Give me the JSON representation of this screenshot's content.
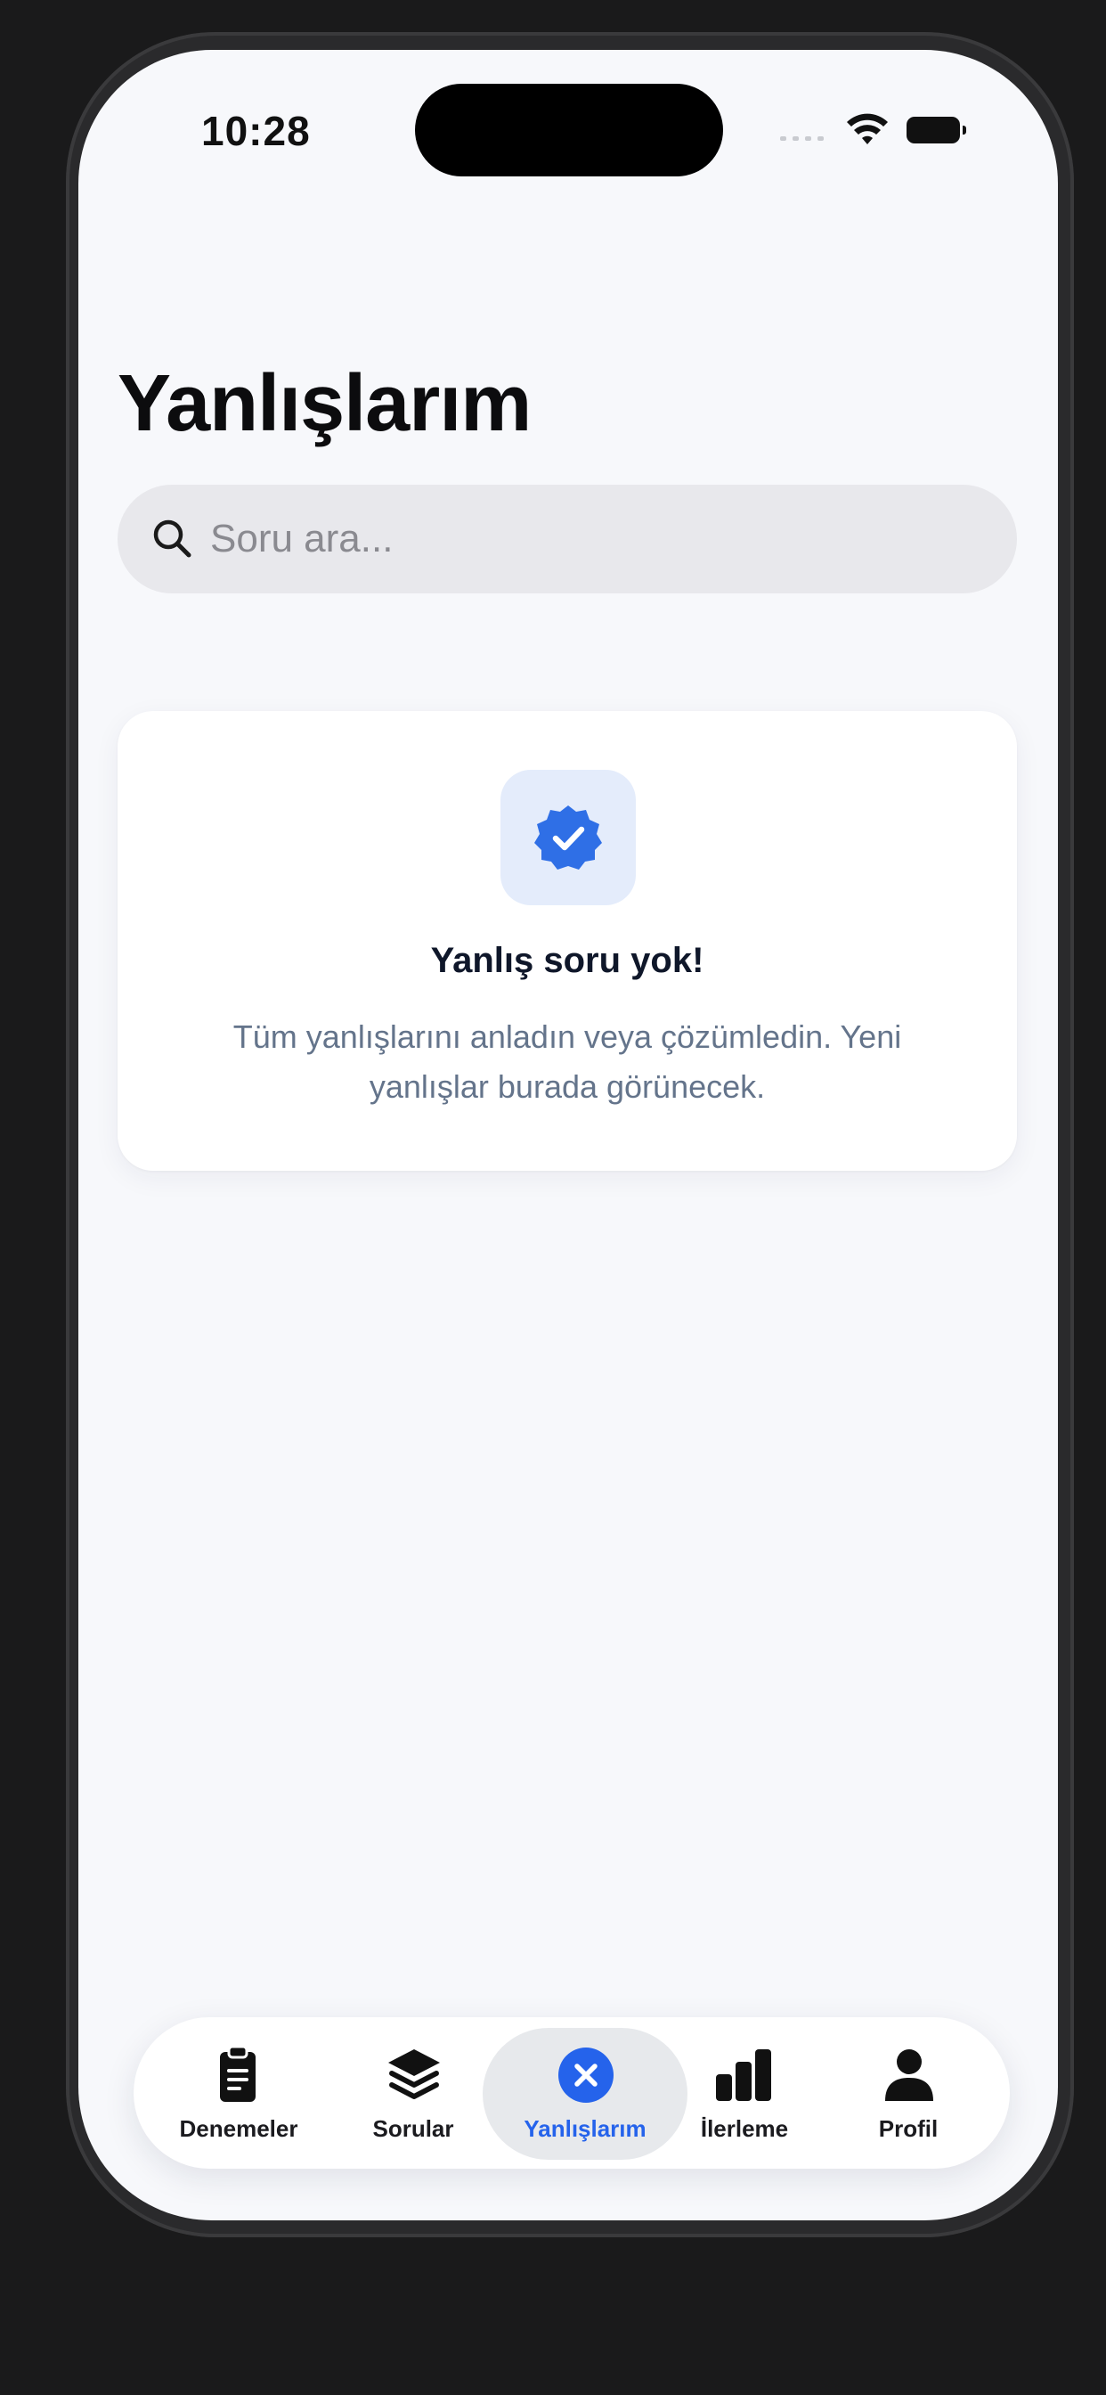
{
  "status_bar": {
    "time": "10:28"
  },
  "header": {
    "title": "Yanlışlarım"
  },
  "search": {
    "placeholder": "Soru ara..."
  },
  "empty_state": {
    "title": "Yanlış soru yok!",
    "description": "Tüm yanlışlarını anladın veya çözümledin. Yeni yanlışlar burada görünecek.",
    "icon": "verified-badge-icon"
  },
  "tabbar": {
    "items": [
      {
        "label": "Denemeler",
        "icon": "clipboard-icon"
      },
      {
        "label": "Sorular",
        "icon": "layers-icon"
      },
      {
        "label": "Yanlışlarım",
        "icon": "x-circle-icon",
        "active": true
      },
      {
        "label": "İlerleme",
        "icon": "bar-chart-icon"
      },
      {
        "label": "Profil",
        "icon": "person-icon"
      }
    ]
  },
  "colors": {
    "accent": "#2563eb",
    "background": "#f7f8fb"
  }
}
